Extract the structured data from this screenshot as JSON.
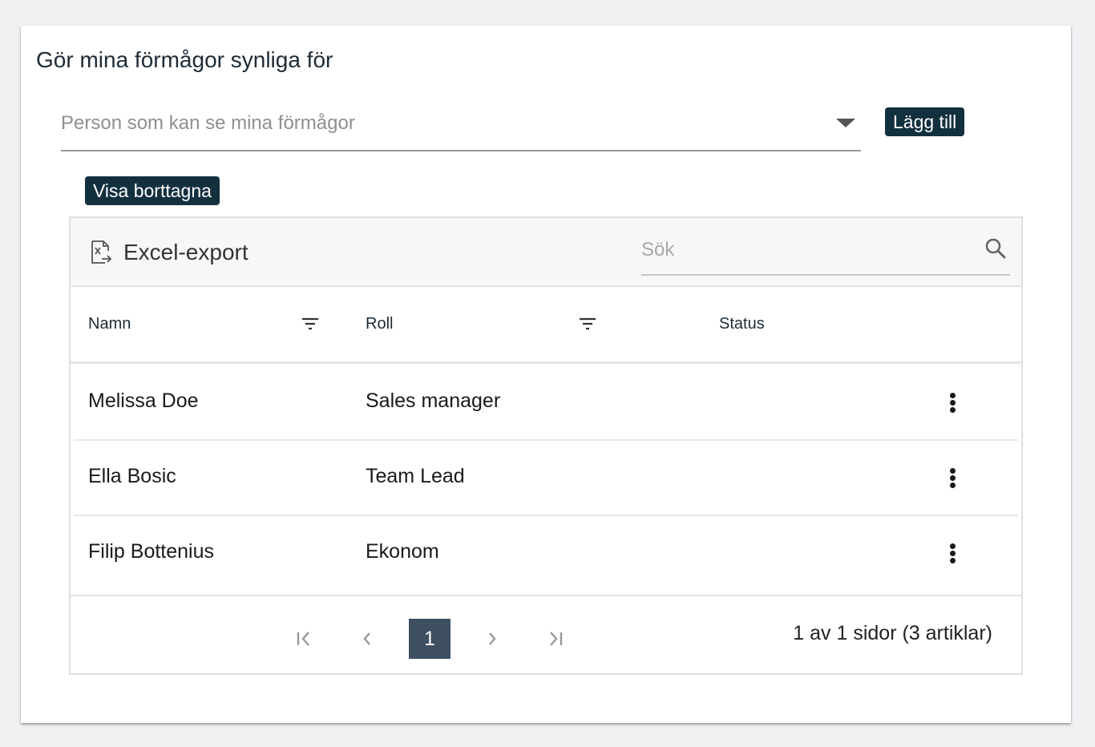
{
  "page": {
    "title": "Gör mina förmågor synliga för"
  },
  "person_select": {
    "placeholder": "Person som kan se mina förmågor",
    "icon": "chevron-down-icon"
  },
  "buttons": {
    "add_label": "Lägg till",
    "show_removed_label": "Visa borttagna"
  },
  "toolbar": {
    "excel_label": "Excel-export",
    "excel_icon": "excel-file-icon",
    "search_placeholder": "Sök",
    "search_icon": "search-icon"
  },
  "table": {
    "columns": [
      {
        "label": "Namn",
        "filterable": true
      },
      {
        "label": "Roll",
        "filterable": true
      },
      {
        "label": "Status",
        "filterable": false
      }
    ],
    "rows": [
      {
        "name": "Melissa Doe",
        "role": "Sales manager",
        "status": ""
      },
      {
        "name": "Ella Bosic",
        "role": "Team Lead",
        "status": ""
      },
      {
        "name": "Filip Bottenius",
        "role": "Ekonom",
        "status": ""
      }
    ]
  },
  "pager": {
    "current_page": "1",
    "info": "1 av 1 sidor (3 artiklar)"
  },
  "colors": {
    "primary_button": "#13303f",
    "current_page": "#3e5060",
    "background": "#f1f1f4"
  }
}
